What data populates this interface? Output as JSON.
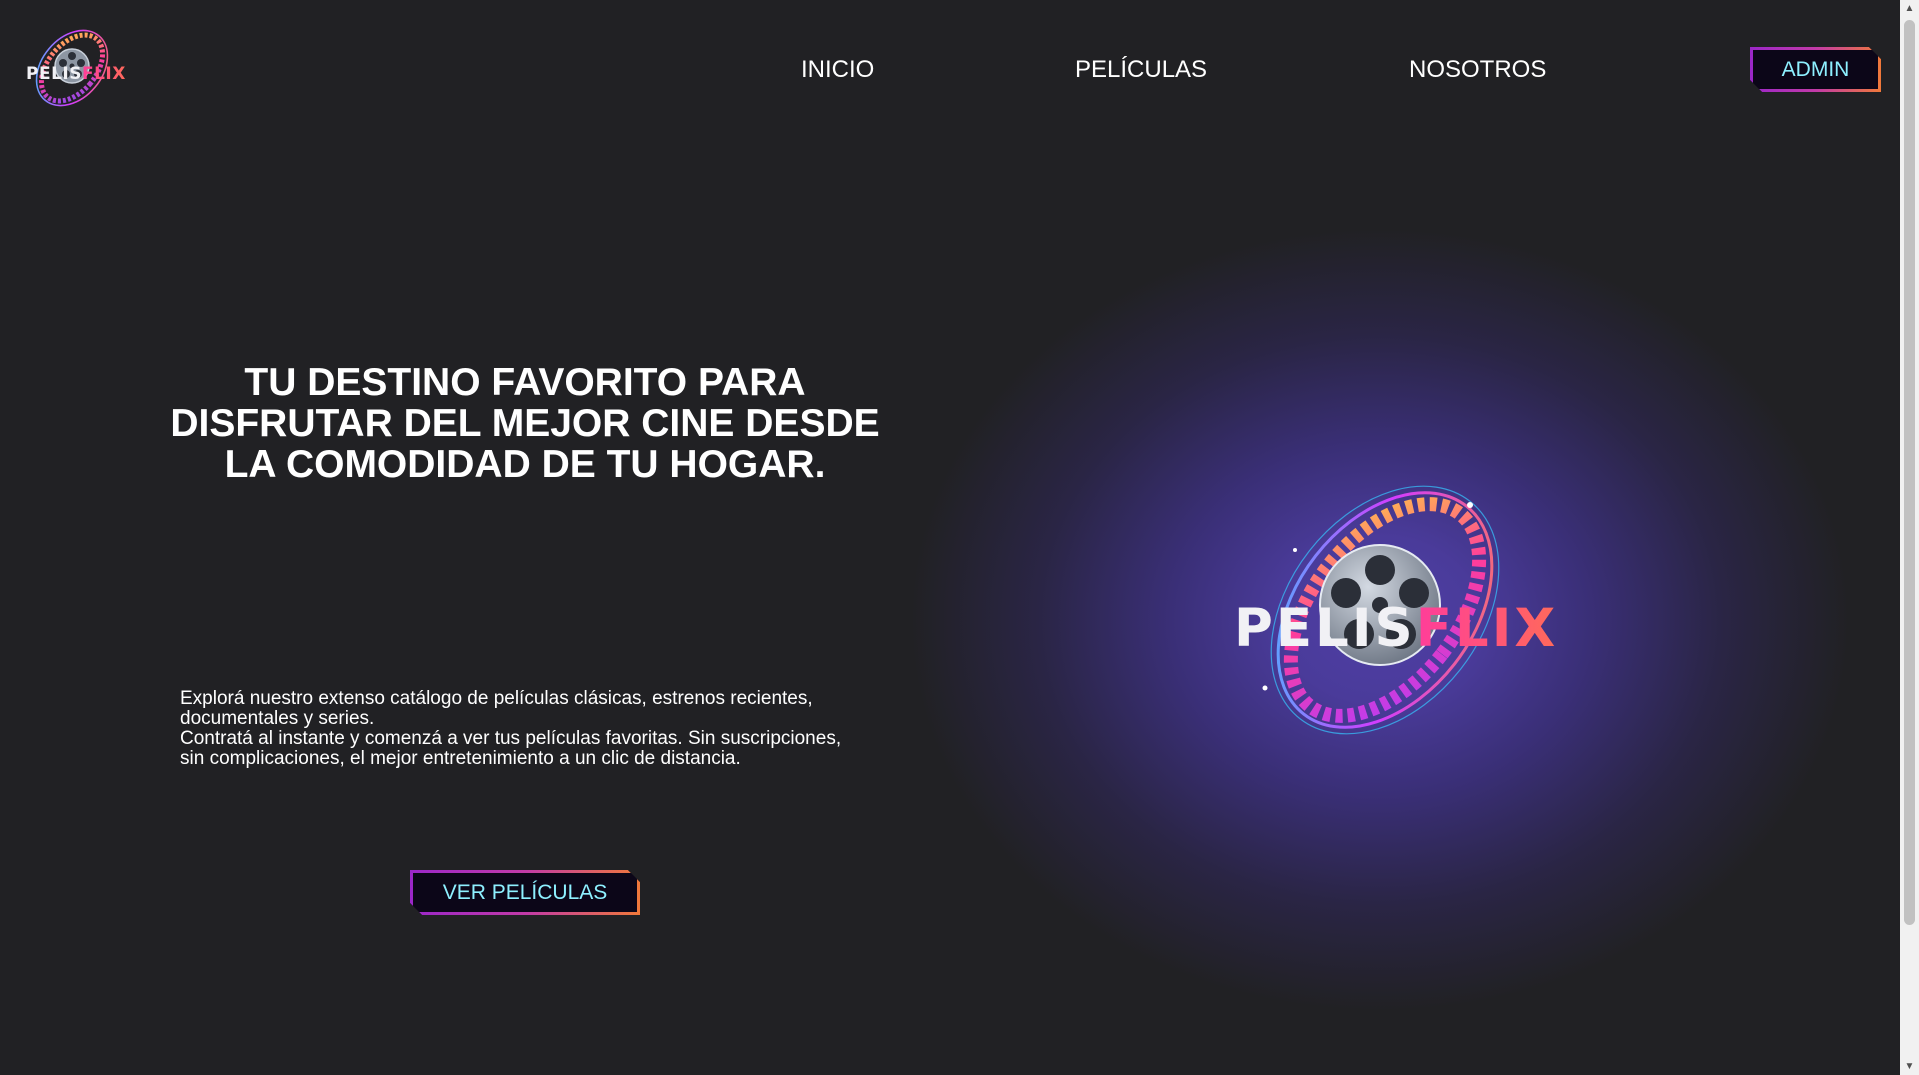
{
  "header": {
    "logo": {
      "pelis": "PELIS",
      "flix": "FLIX"
    },
    "nav": [
      {
        "label": "INICIO"
      },
      {
        "label": "PELÍCULAS"
      },
      {
        "label": "NOSOTROS"
      }
    ],
    "admin_label": "ADMIN"
  },
  "hero": {
    "title": "TU DESTINO FAVORITO PARA DISFRUTAR DEL MEJOR CINE DESDE LA COMODIDAD DE TU HOGAR.",
    "paragraph_1": "Explorá nuestro extenso catálogo de películas clásicas, estrenos recientes, documentales y series.",
    "paragraph_2": "Contratá al instante y comenzá a ver tus películas favoritas. Sin suscripciones, sin complicaciones, el mejor entretenimiento a un clic de distancia.",
    "cta_label": "VER PELÍCULAS",
    "logo": {
      "pelis": "PELIS",
      "flix": "FLIX"
    }
  },
  "colors": {
    "background": "#212124",
    "accent_text": "#8ef0ff",
    "button_bg": "#0c0618",
    "border_start": "#9b27c9",
    "border_end": "#f0783a",
    "glow": "#4f3fa6",
    "flix": "#ff4f8a"
  },
  "icons": {
    "logo_mark": "film-reel-icon",
    "scroll_up": "scroll-up-arrow-icon",
    "scroll_down": "scroll-down-arrow-icon"
  }
}
